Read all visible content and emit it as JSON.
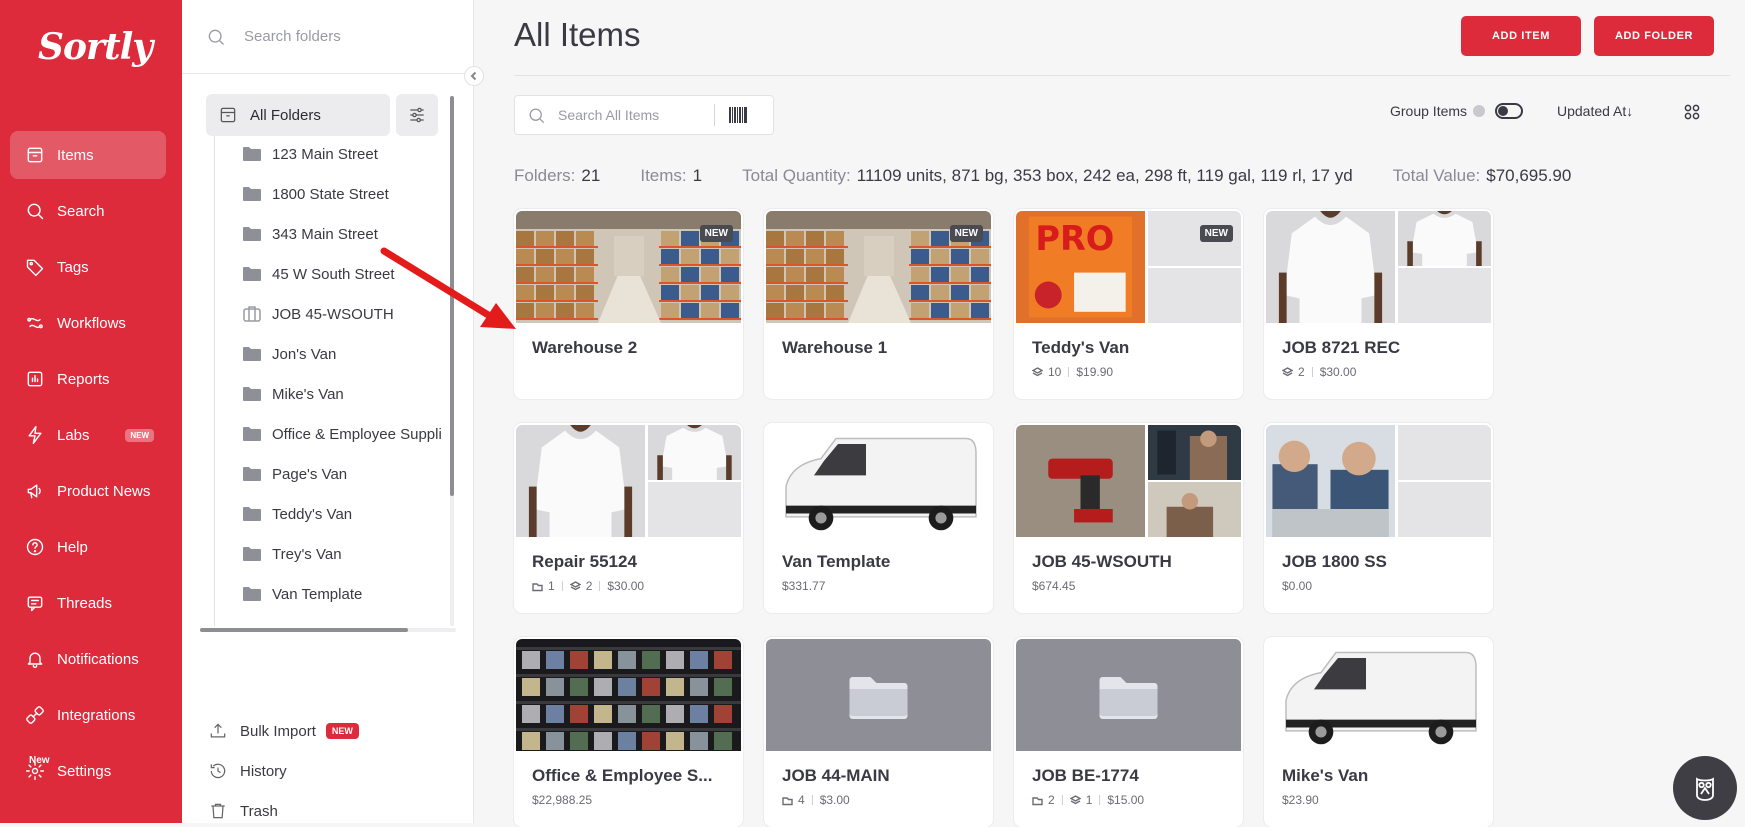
{
  "brand": {
    "logo": "Sortly",
    "accent": "#dd2b3c"
  },
  "nav": {
    "items": [
      {
        "label": "Items",
        "icon": "items-icon",
        "active": true
      },
      {
        "label": "Search",
        "icon": "search-icon"
      },
      {
        "label": "Tags",
        "icon": "tag-icon"
      },
      {
        "label": "Workflows",
        "icon": "workflows-icon"
      },
      {
        "label": "Reports",
        "icon": "reports-icon"
      },
      {
        "label": "Labs",
        "icon": "labs-icon",
        "badge": "NEW"
      },
      {
        "label": "Product News",
        "icon": "megaphone-icon"
      },
      {
        "label": "Help",
        "icon": "help-icon"
      },
      {
        "label": "Threads",
        "icon": "threads-icon"
      },
      {
        "label": "Notifications",
        "icon": "bell-icon"
      },
      {
        "label": "Integrations",
        "icon": "integrations-icon"
      },
      {
        "label": "Settings",
        "icon": "gear-icon",
        "badge": "New"
      }
    ]
  },
  "folders": {
    "search_placeholder": "Search folders",
    "all_label": "All Folders",
    "list": [
      "123 Main Street",
      "1800 State Street",
      "343 Main Street",
      "45 W South Street",
      "JOB 45-WSOUTH",
      "Jon's Van",
      "Mike's Van",
      "Office & Employee Suppli",
      "Page's Van",
      "Teddy's Van",
      "Trey's Van",
      "Van Template"
    ],
    "bottom": {
      "bulk_import": "Bulk Import",
      "bulk_badge": "NEW",
      "history": "History",
      "trash": "Trash"
    }
  },
  "main": {
    "title": "All Items",
    "add_item": "ADD ITEM",
    "add_folder": "ADD FOLDER",
    "search_placeholder": "Search All Items",
    "group_items": "Group Items",
    "sort_label": "Updated At",
    "stats": {
      "folders_label": "Folders:",
      "folders_value": "21",
      "items_label": "Items:",
      "items_value": "1",
      "quantity_label": "Total Quantity:",
      "quantity_value": "11109 units, 871 bg, 353 box, 242 ea, 298 ft, 119 gal, 119 rl, 17 yd",
      "value_label": "Total Value:",
      "value_value": "$70,695.90"
    },
    "cards": [
      {
        "title": "Warehouse 2",
        "badge": "NEW",
        "thumb": "warehouse",
        "meta": []
      },
      {
        "title": "Warehouse 1",
        "badge": "NEW",
        "thumb": "warehouse",
        "meta": []
      },
      {
        "title": "Teddy's Van",
        "badge": "NEW",
        "thumb": "pro-grid",
        "meta": [
          {
            "icon": "stack-icon",
            "text": "10"
          },
          {
            "text": "$19.90"
          }
        ]
      },
      {
        "title": "JOB 8721 REC",
        "thumb": "tshirt-grid",
        "meta": [
          {
            "icon": "stack-icon",
            "text": "2"
          },
          {
            "text": "$30.00"
          }
        ]
      },
      {
        "title": "Repair 55124",
        "thumb": "tshirt-grid",
        "meta": [
          {
            "icon": "folder-icon",
            "text": "1"
          },
          {
            "icon": "stack-icon",
            "text": "2"
          },
          {
            "text": "$30.00"
          }
        ]
      },
      {
        "title": "Van Template",
        "thumb": "van",
        "meta": [
          {
            "text": "$331.77"
          }
        ]
      },
      {
        "title": "JOB 45-WSOUTH",
        "thumb": "drill-grid",
        "meta": [
          {
            "text": "$674.45"
          }
        ]
      },
      {
        "title": "JOB 1800 SS",
        "thumb": "workers-grid",
        "meta": [
          {
            "text": "$0.00"
          }
        ]
      },
      {
        "title": "Office & Employee S...",
        "thumb": "shelves",
        "meta": [
          {
            "text": "$22,988.25"
          }
        ]
      },
      {
        "title": "JOB 44-MAIN",
        "thumb": "folder",
        "meta": [
          {
            "icon": "folder-icon",
            "text": "4"
          },
          {
            "text": "$3.00"
          }
        ]
      },
      {
        "title": "JOB BE-1774",
        "thumb": "folder",
        "meta": [
          {
            "icon": "folder-icon",
            "text": "2"
          },
          {
            "icon": "stack-icon",
            "text": "1"
          },
          {
            "text": "$15.00"
          }
        ]
      },
      {
        "title": "Mike's Van",
        "thumb": "van",
        "meta": [
          {
            "text": "$23.90"
          }
        ]
      }
    ]
  }
}
